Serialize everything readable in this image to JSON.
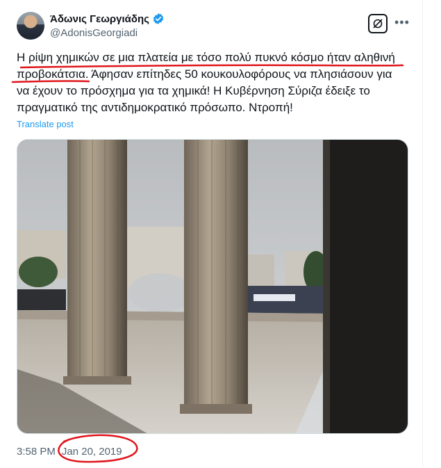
{
  "author": {
    "display_name": "Άδωνις Γεωργιάδης",
    "handle": "@AdonisGeorgiadi",
    "verified": true
  },
  "tweet": {
    "line1": "Η ρίψη χημικών σε μια πλατεία με τόσο πολύ πυκνό κόσμο ήταν αληθινή",
    "line2": "προβοκάτσια. Άφησαν επίτηδες 50 κουκουλοφόρους να πλησιάσουν για",
    "line3": "να έχουν το πρόσχημα για τα χημικά! Η Κυβέρνηση Σύριζα έδειξε το",
    "line4": "πραγματικό της αντιδημοκρατικό πρόσωπο. Ντροπή!",
    "translate_label": "Translate post",
    "time": "3:58 PM",
    "separator": "·",
    "date": "Jan 20, 2019"
  },
  "icons": {
    "grok": "grok-icon",
    "more": "more-icon",
    "verified": "verified-badge-icon"
  },
  "colors": {
    "link": "#1d9bf0",
    "annotation": "#e0141c",
    "secondary_text": "#536471"
  }
}
